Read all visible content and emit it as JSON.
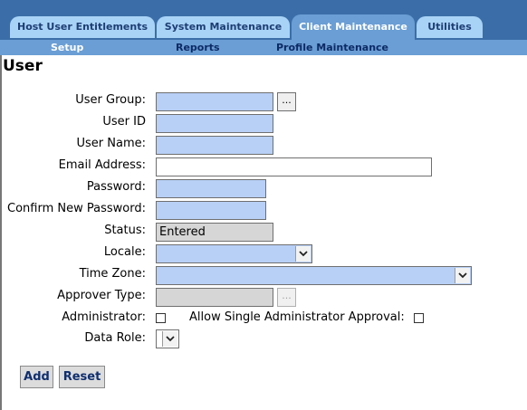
{
  "tabs": [
    {
      "label": "Host User Entitlements"
    },
    {
      "label": "System Maintenance"
    },
    {
      "label": "Client Maintenance"
    },
    {
      "label": "Utilities"
    }
  ],
  "subnav": [
    {
      "label": "Setup"
    },
    {
      "label": "Reports"
    },
    {
      "label": "Profile Maintenance"
    }
  ],
  "page": {
    "title": "User"
  },
  "form": {
    "user_group": {
      "label": "User Group:",
      "value": ""
    },
    "browse_label": "...",
    "user_id": {
      "label": "User ID",
      "value": ""
    },
    "user_name": {
      "label": "User Name:",
      "value": ""
    },
    "email": {
      "label": "Email Address:",
      "value": ""
    },
    "password": {
      "label": "Password:",
      "value": ""
    },
    "confirm_password": {
      "label": "Confirm New Password:",
      "value": ""
    },
    "status": {
      "label": "Status:",
      "value": "Entered"
    },
    "locale": {
      "label": "Locale:",
      "value": ""
    },
    "time_zone": {
      "label": "Time Zone:",
      "value": ""
    },
    "approver_type": {
      "label": "Approver Type:",
      "value": ""
    },
    "administrator": {
      "label": "Administrator:",
      "checked": false
    },
    "single_admin_approval": {
      "label": "Allow Single Administrator Approval:",
      "checked": false
    },
    "data_role": {
      "label": "Data Role:",
      "value": ""
    }
  },
  "buttons": {
    "add": "Add",
    "reset": "Reset"
  },
  "colors": {
    "header_blue": "#3b6ea8",
    "active_tab": "#6a9ed4",
    "inactive_tab": "#a9d3f6",
    "required_field": "#b8d0f6",
    "disabled_field": "#d6d6d6"
  }
}
